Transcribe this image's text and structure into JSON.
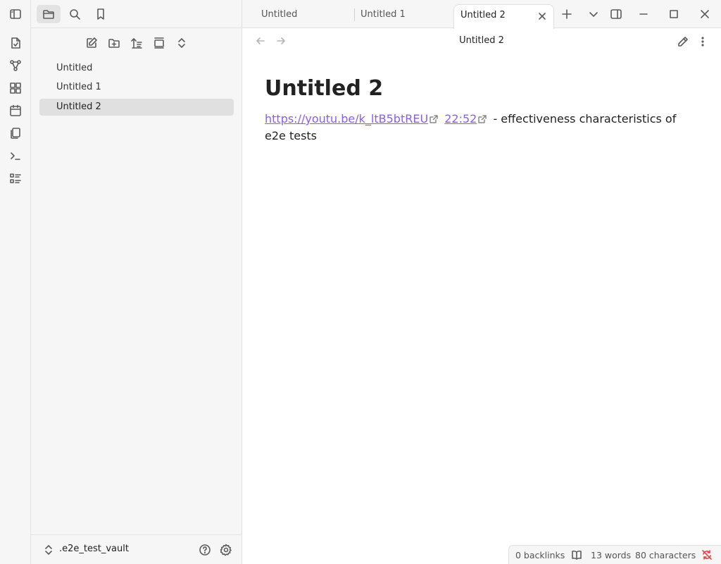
{
  "ribbon": {
    "items": [
      {
        "name": "open-quick-switcher-icon"
      },
      {
        "name": "graph-view-icon"
      },
      {
        "name": "canvas-icon"
      },
      {
        "name": "daily-note-icon"
      },
      {
        "name": "templates-icon"
      },
      {
        "name": "command-palette-icon"
      },
      {
        "name": "outline-icon"
      }
    ]
  },
  "sidebar": {
    "tabs": [
      "files-icon",
      "search-icon",
      "bookmarks-icon"
    ],
    "actions": [
      "new-note-icon",
      "new-folder-icon",
      "sort-icon",
      "auto-reveal-icon",
      "collapse-all-icon"
    ],
    "files": [
      {
        "label": "Untitled"
      },
      {
        "label": "Untitled 1"
      },
      {
        "label": "Untitled 2",
        "active": true
      }
    ],
    "vault": {
      "name": ".e2e_test_vault"
    }
  },
  "tabs": [
    {
      "label": "Untitled"
    },
    {
      "label": "Untitled 1"
    },
    {
      "label": "Untitled 2",
      "active": true
    }
  ],
  "view": {
    "title": "Untitled 2"
  },
  "note": {
    "heading": "Untitled 2",
    "link1": "https://youtu.be/k_ltB5btREU",
    "link2": "22:52",
    "text": " - effectiveness characteristics of e2e tests"
  },
  "status": {
    "backlinks": "0 backlinks",
    "words": "13 words",
    "characters": "80 characters"
  },
  "colors": {
    "accent": "#8a5cf5",
    "sync_error": "#e0454b"
  }
}
